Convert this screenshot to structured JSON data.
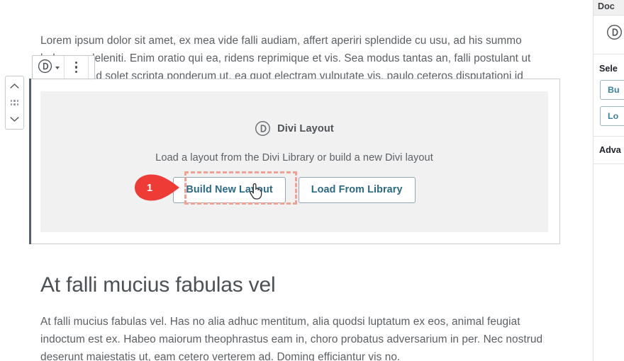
{
  "editor": {
    "paragraph_1": "Lorem ipsum dolor sit amet, ex mea vide falli audiam, affert aperiri splendide cu usu, ad his summo habemus deleniti. Enim oratio qui ea, ridens reprimique et vis. Sea modus tantas an, falli postulant ut cum. Sed ad solet scripta ponderum ut, ea quot electram vulputate vis, paulo ceteros disputationi id eam.",
    "heading": "At falli mucius fabulas vel",
    "paragraph_2": "At falli mucius fabulas vel. Has no alia adhuc mentitum, alia quodsi luptatum ex eos, animal feugiat indoctum est ex. Habeo maiorum theophrastus eam in, choro probatus adversarium in per. Nec nostrud deserunt maiestatis ut, eam cetero verterem ad. Doming efficiantur vis no."
  },
  "block_mover": {
    "move_up": "move-up",
    "drag": "drag-handle",
    "move_down": "move-down"
  },
  "block_toolbar": {
    "block_type_icon": "divi-logo-icon",
    "block_type_caret": "chevron-down-icon",
    "more_options": "more-options-icon"
  },
  "divi_block": {
    "brand_icon": "divi-logo-icon",
    "brand_label": "Divi Layout",
    "description": "Load a layout from the Divi Library or build a new Divi layout",
    "build_button": "Build New Layout",
    "library_button": "Load From Library"
  },
  "annotation": {
    "number": "1",
    "marker_color": "#ef3b36",
    "highlight_color": "#f0a193",
    "target": "Build New Layout"
  },
  "cursor": {
    "type": "pointer-hand"
  },
  "sidebar": {
    "tab_label": "Doc",
    "divi_icon": "divi-logo-icon",
    "select_heading": "Sele",
    "build_button": "Bu",
    "library_button": "Lo",
    "advanced_heading": "Adva"
  },
  "colors": {
    "accent_blue": "#2b6a85",
    "marker_red": "#ef3b36",
    "highlight_pink": "#f0a193",
    "placeholder_bg": "#f1f1f2",
    "select_bar": "#56606a",
    "body_text": "#5b5f63"
  }
}
